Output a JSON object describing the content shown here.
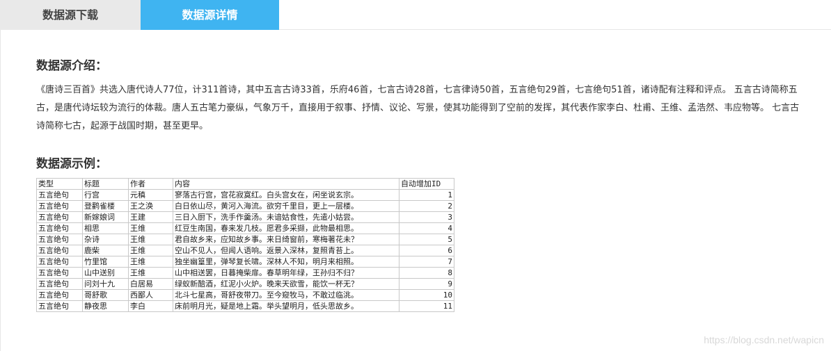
{
  "tabs": {
    "download": "数据源下载",
    "detail": "数据源详情"
  },
  "intro": {
    "title": "数据源介绍：",
    "text": "《唐诗三百首》共选入唐代诗人77位，计311首诗，其中五言古诗33首，乐府46首，七言古诗28首，七言律诗50首，五言绝句29首，七言绝句51首，诸诗配有注释和评点。 五言古诗简称五古，是唐代诗坛较为流行的体裁。唐人五古笔力豪纵，气象万千，直接用于叙事、抒情、议论、写景，使其功能得到了空前的发挥，其代表作家李白、杜甫、王维、孟浩然、韦应物等。 七言古诗简称七古，起源于战国时期，甚至更早。"
  },
  "example": {
    "title": "数据源示例：",
    "headers": [
      "类型",
      "标题",
      "作者",
      "内容",
      "自动增加ID"
    ],
    "rows": [
      [
        "五言绝句",
        "行宫",
        "元稹",
        "寥落古行宫，宫花寂寞红。白头宫女在，闲坐说玄宗。",
        "1"
      ],
      [
        "五言绝句",
        "登鹳雀楼",
        "王之涣",
        "白日依山尽，黄河入海流。欲穷千里目，更上一层楼。",
        "2"
      ],
      [
        "五言绝句",
        "新嫁娘词",
        "王建",
        "三日入厨下，洗手作羹汤。未谙姑食性，先遣小姑尝。",
        "3"
      ],
      [
        "五言绝句",
        "相思",
        "王维",
        "红豆生南国，春来发几枝。愿君多采撷，此物最相思。",
        "4"
      ],
      [
        "五言绝句",
        "杂诗",
        "王维",
        "君自故乡来，应知故乡事。来日绮窗前，寒梅著花未？",
        "5"
      ],
      [
        "五言绝句",
        "鹿柴",
        "王维",
        "空山不见人，但闻人语响。返景入深林，复照青苔上。",
        "6"
      ],
      [
        "五言绝句",
        "竹里馆",
        "王维",
        "独坐幽篁里，弹琴复长啸。深林人不知，明月来相照。",
        "7"
      ],
      [
        "五言绝句",
        "山中送别",
        "王维",
        "山中相送罢，日暮掩柴扉。春草明年绿，王孙归不归？",
        "8"
      ],
      [
        "五言绝句",
        "问刘十九",
        "白居易",
        "绿蚁新醅酒，红泥小火炉。晚来天欲雪，能饮一杯无？",
        "9"
      ],
      [
        "五言绝句",
        "哥舒歌",
        "西鄙人",
        "北斗七星高，哥舒夜带刀。至今窥牧马，不敢过临洮。",
        "10"
      ],
      [
        "五言绝句",
        "静夜思",
        "李白",
        "床前明月光，疑是地上霜。举头望明月，低头思故乡。",
        "11"
      ]
    ]
  },
  "watermark": "https://blog.csdn.net/wapicn",
  "colors": {
    "active_tab": "#3fb4f1",
    "inactive_tab": "#e9e9e9"
  }
}
